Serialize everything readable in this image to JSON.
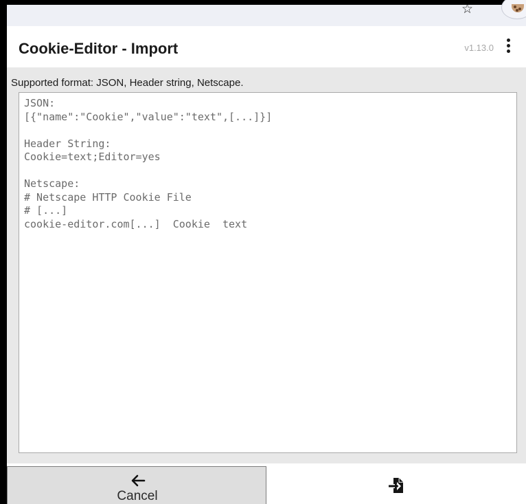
{
  "browser": {
    "star_glyph": "☆",
    "extension_icon": "cookie-icon"
  },
  "popup": {
    "title": "Cookie-Editor - Import",
    "version": "v1.13.0",
    "menu_icon": "kebab-menu-icon"
  },
  "import_form": {
    "supported_formats_label": "Supported format: JSON, Header string, Netscape.",
    "textarea_value": "",
    "textarea_placeholder": "JSON:\n[{\"name\":\"Cookie\",\"value\":\"text\",[...]}]\n\nHeader String:\nCookie=text;Editor=yes\n\nNetscape:\n# Netscape HTTP Cookie File\n# [...]\ncookie-editor.com[...]  Cookie  text"
  },
  "footer": {
    "cancel_label": "Cancel",
    "cancel_icon": "arrow-left-icon",
    "import_icon": "file-import-icon"
  },
  "colors": {
    "content_background": "#e8e8e8",
    "cancel_background": "#dedede",
    "version_text": "#a8a8a8",
    "placeholder_text": "#6b6b6b"
  }
}
